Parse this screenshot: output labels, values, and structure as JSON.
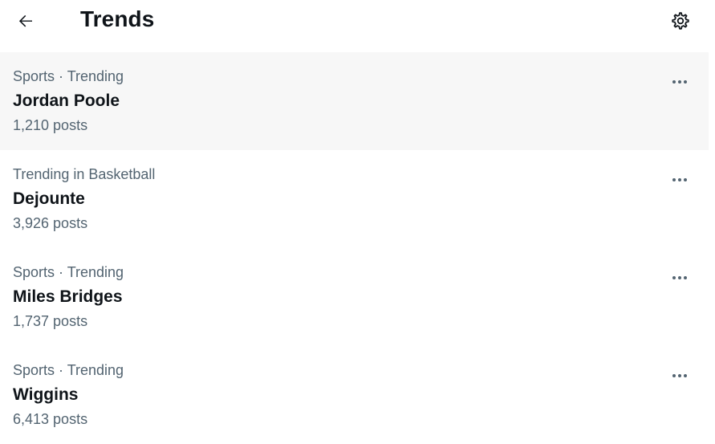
{
  "header": {
    "title": "Trends",
    "back_icon": "arrow-left-icon",
    "settings_icon": "gear-icon"
  },
  "trends": [
    {
      "context": "Sports · Trending",
      "name": "Jordan Poole",
      "count": "1,210 posts",
      "hovered": true
    },
    {
      "context": "Trending in Basketball",
      "name": "Dejounte",
      "count": "3,926 posts",
      "hovered": false
    },
    {
      "context": "Sports · Trending",
      "name": "Miles Bridges",
      "count": "1,737 posts",
      "hovered": false
    },
    {
      "context": "Sports · Trending",
      "name": "Wiggins",
      "count": "6,413 posts",
      "hovered": false
    }
  ],
  "more_icon": "more-horizontal-icon",
  "colors": {
    "text_primary": "#0f1419",
    "text_secondary": "#536471",
    "hover_background": "#f7f7f7"
  }
}
